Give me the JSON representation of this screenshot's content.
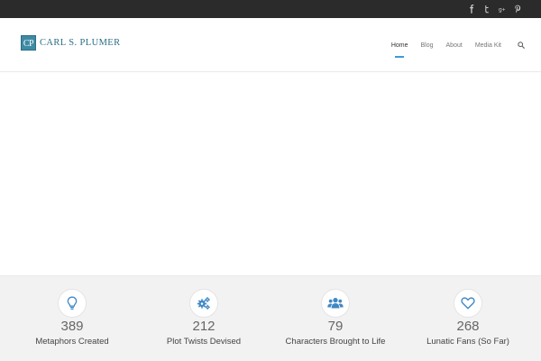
{
  "topbar": {
    "social": [
      {
        "name": "facebook-icon",
        "glyph": "f"
      },
      {
        "name": "twitter-icon",
        "glyph": "t"
      },
      {
        "name": "google-plus-icon",
        "glyph": "g+"
      },
      {
        "name": "pinterest-icon",
        "glyph": "p"
      }
    ]
  },
  "header": {
    "logo_mark": "CP",
    "logo_text": "CARL S. PLUMER",
    "nav": [
      "Home",
      "Blog",
      "About",
      "Media Kit"
    ],
    "active_nav": "Home",
    "search_icon": "search-icon"
  },
  "stats": [
    {
      "icon": "lightbulb-icon",
      "value": "389",
      "label": "Metaphors Created"
    },
    {
      "icon": "gears-icon",
      "value": "212",
      "label": "Plot Twists Devised"
    },
    {
      "icon": "users-icon",
      "value": "79",
      "label": "Characters Brought to Life"
    },
    {
      "icon": "heart-icon",
      "value": "268",
      "label": "Lunatic Fans (So Far)"
    }
  ],
  "colors": {
    "topbar": "#2b2b2b",
    "brand": "#2a6f85",
    "accent": "#3f9ad6",
    "stats_bg": "#f2f2f2",
    "icon": "#3f88c5"
  }
}
